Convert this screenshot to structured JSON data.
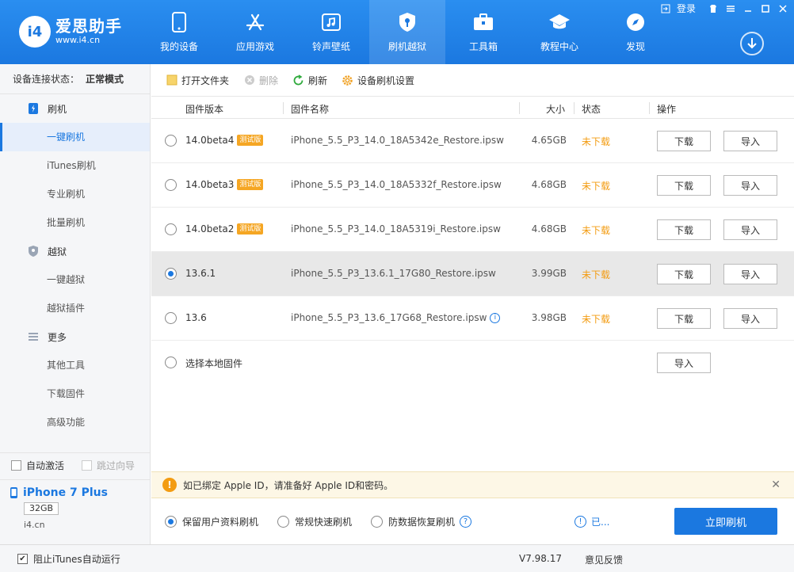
{
  "app": {
    "name": "爱思助手",
    "url": "www.i4.cn",
    "badge": "i4",
    "login": "登录",
    "accent": "#1b78e0",
    "header_gradient": [
      "#2a8ef0",
      "#1b78e0"
    ]
  },
  "nav": [
    {
      "label": "我的设备",
      "icon": "phone-icon"
    },
    {
      "label": "应用游戏",
      "icon": "app-store-icon"
    },
    {
      "label": "铃声壁纸",
      "icon": "music-icon"
    },
    {
      "label": "刷机越狱",
      "icon": "shield-key-icon"
    },
    {
      "label": "工具箱",
      "icon": "toolbox-icon"
    },
    {
      "label": "教程中心",
      "icon": "graduation-cap-icon"
    },
    {
      "label": "发现",
      "icon": "compass-icon"
    }
  ],
  "nav_active": "刷机越狱",
  "sidebar": {
    "status_label": "设备连接状态：",
    "status_value": "正常模式",
    "groups": [
      {
        "label": "刷机",
        "icon": "flash-phone-icon",
        "items": [
          "一键刷机",
          "iTunes刷机",
          "专业刷机",
          "批量刷机"
        ]
      },
      {
        "label": "越狱",
        "icon": "jailbreak-shield-icon",
        "items": [
          "一键越狱",
          "越狱插件"
        ]
      },
      {
        "label": "更多",
        "icon": "menu-lines-icon",
        "items": [
          "其他工具",
          "下载固件",
          "高级功能"
        ]
      }
    ],
    "active_item": "一键刷机",
    "auto_activate": "自动激活",
    "skip_guide": "跳过向导"
  },
  "device": {
    "name": "iPhone 7 Plus",
    "capacity": "32GB",
    "source": "i4.cn"
  },
  "toolbar": {
    "open_folder": "打开文件夹",
    "delete": "删除",
    "refresh": "刷新",
    "settings": "设备刷机设置"
  },
  "table": {
    "headers": {
      "version": "固件版本",
      "name": "固件名称",
      "size": "大小",
      "status": "状态",
      "action": "操作"
    },
    "beta_tag": "测试版",
    "download_label": "下载",
    "import_label": "导入",
    "rows": [
      {
        "version": "14.0beta4",
        "beta": true,
        "name": "iPhone_5.5_P3_14.0_18A5342e_Restore.ipsw",
        "size": "4.65GB",
        "status": "未下载",
        "selected": false
      },
      {
        "version": "14.0beta3",
        "beta": true,
        "name": "iPhone_5.5_P3_14.0_18A5332f_Restore.ipsw",
        "size": "4.68GB",
        "status": "未下载",
        "selected": false
      },
      {
        "version": "14.0beta2",
        "beta": true,
        "name": "iPhone_5.5_P3_14.0_18A5319i_Restore.ipsw",
        "size": "4.68GB",
        "status": "未下载",
        "selected": false
      },
      {
        "version": "13.6.1",
        "beta": false,
        "name": "iPhone_5.5_P3_13.6.1_17G80_Restore.ipsw",
        "size": "3.99GB",
        "status": "未下载",
        "selected": true
      },
      {
        "version": "13.6",
        "beta": false,
        "name": "iPhone_5.5_P3_13.6_17G68_Restore.ipsw",
        "size": "3.98GB",
        "status": "未下载",
        "selected": false,
        "info": true
      }
    ],
    "local_row": "选择本地固件",
    "status_color": "#f39c12"
  },
  "notice": {
    "text": "如已绑定 Apple ID，请准备好 Apple ID和密码。",
    "icon": "!"
  },
  "options": {
    "keep_data": "保留用户资料刷机",
    "quick": "常规快速刷机",
    "anti_recovery": "防数据恢复刷机",
    "help": "?",
    "warn_link": "已...",
    "flash_button": "立即刷机"
  },
  "bottom": {
    "block_itunes": "阻止iTunes自动运行",
    "version": "V7.98.17",
    "feedback": "意见反馈"
  }
}
